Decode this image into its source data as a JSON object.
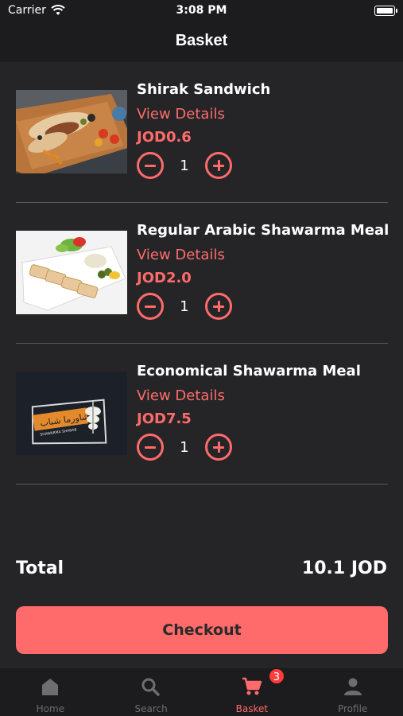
{
  "status_bar": {
    "carrier": "Carrier",
    "time": "3:08 PM"
  },
  "nav": {
    "title": "Basket"
  },
  "basket": {
    "items": [
      {
        "name": "Shirak Sandwich",
        "details_label": "View Details",
        "price": "JOD0.6",
        "quantity": "1"
      },
      {
        "name": "Regular Arabic Shawarma Meal",
        "details_label": "View Details",
        "price": "JOD2.0",
        "quantity": "1"
      },
      {
        "name": "Economical Shawarma Meal",
        "details_label": "View Details",
        "price": "JOD7.5",
        "quantity": "1"
      }
    ],
    "total_label": "Total",
    "total_amount": "10.1 JOD",
    "checkout_label": "Checkout"
  },
  "logo_text": {
    "arabic": "شاورما شباب",
    "latin": "SHAWARMA SHABAB"
  },
  "tabs": [
    {
      "label": "Home",
      "icon": "home-icon"
    },
    {
      "label": "Search",
      "icon": "search-icon"
    },
    {
      "label": "Basket",
      "icon": "cart-icon",
      "badge": "3",
      "active": true
    },
    {
      "label": "Profile",
      "icon": "profile-icon"
    }
  ],
  "colors": {
    "accent": "#ff6b6b",
    "background": "#252527",
    "bars": "#1c1c1e",
    "badge": "#ff3b3b",
    "inactive": "#6e6e72"
  }
}
